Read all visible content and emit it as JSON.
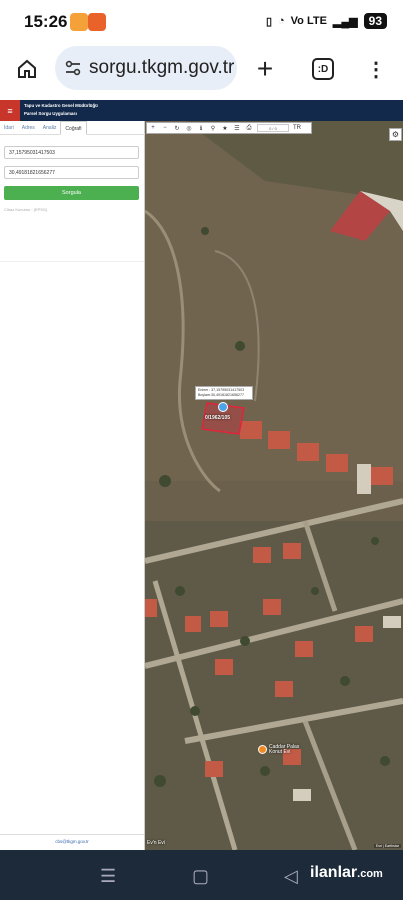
{
  "status_bar": {
    "time": "15:26",
    "network": "Vo LTE",
    "battery": "93"
  },
  "browser": {
    "url": "sorgu.tkgm.gov.tr",
    "tab_label": ":D"
  },
  "site": {
    "title_line1": "Tapu ve Kadastro Genel Müdürlüğü",
    "title_line2": "Parsel Sorgu Uygulaması",
    "accent": "#13294b",
    "menu_color": "#c7352b"
  },
  "sidebar": {
    "tabs": [
      "İdari",
      "Adres",
      "Analiz",
      "Coğrafi"
    ],
    "active_tab": "Coğrafi",
    "latitude_value": "37,15795031417503",
    "longitude_value": "30,49181821656277",
    "query_button": "Sorgula",
    "note": "Cihaz Konumu : (EPSG)",
    "footer_email": "cbs@tkgm.gov.tr"
  },
  "map": {
    "scale_value": "0 / 0",
    "popup_line1": "Enlem : 37,15795031417503",
    "popup_line2": "Boylam:30,49181821656277",
    "parcel_label": "0/1962/105",
    "poi_label_line1": "Caddar Palas",
    "poi_label_line2": "Konut Evi",
    "bottom_label": "Ev'n Evi",
    "attribution": "Esri | Earthstar"
  },
  "navbar": {
    "brand": "ilanlar",
    "brand_suffix": ".com"
  }
}
